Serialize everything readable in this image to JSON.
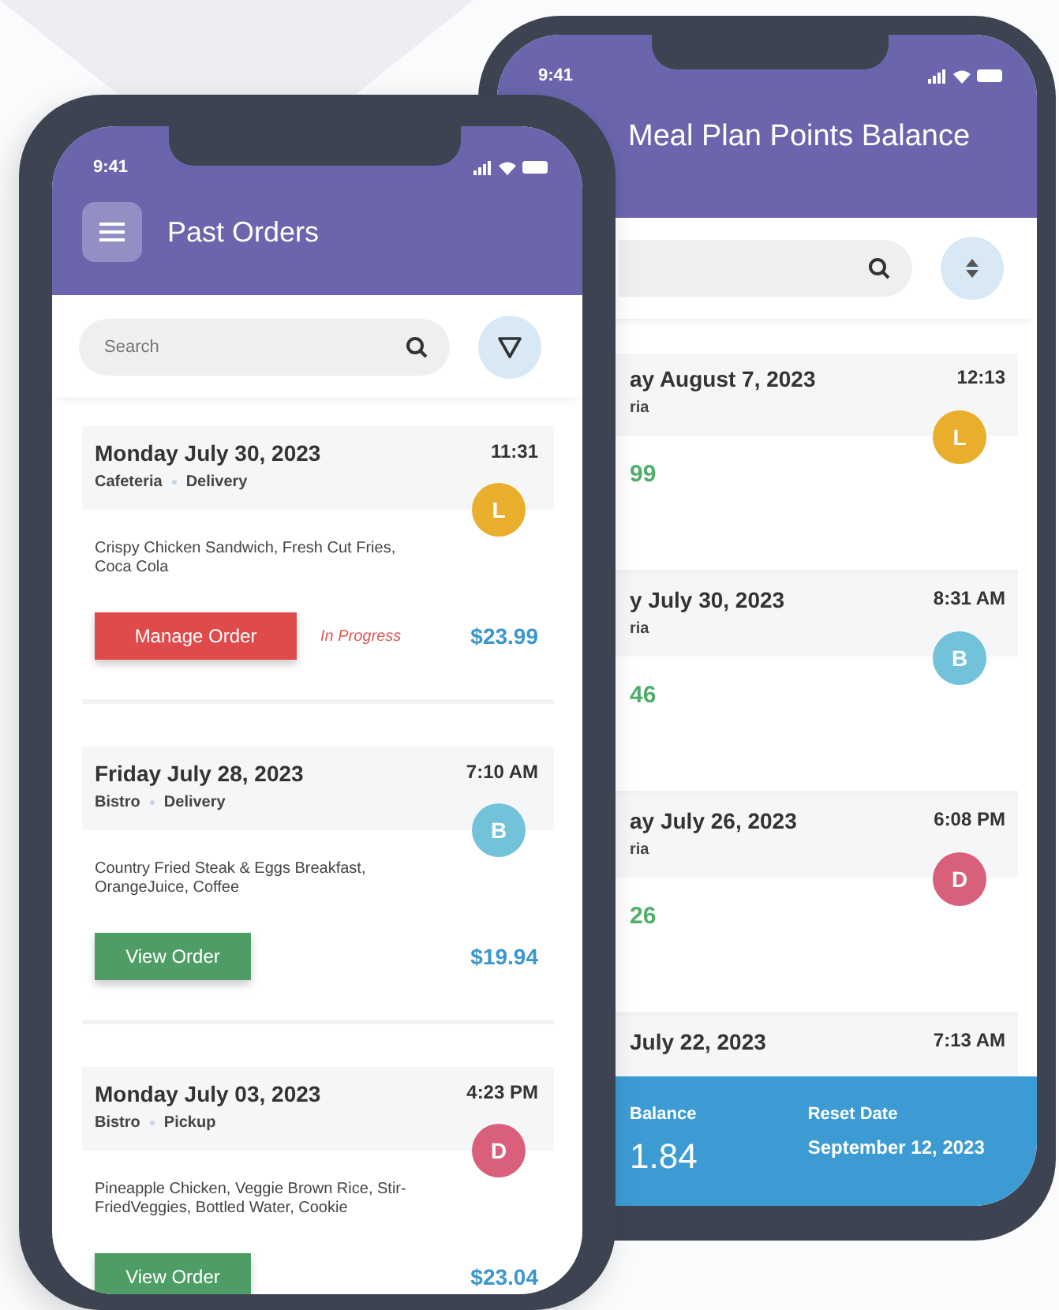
{
  "back_phone": {
    "status_time": "9:41",
    "title": "Meal Plan Points Balance",
    "orders": [
      {
        "date": "ay August 7, 2023",
        "location": "ria",
        "time": "12:13",
        "avatar": "L",
        "color": "#e8ae2c",
        "amount": "99"
      },
      {
        "date": "y July 30, 2023",
        "location": "ria",
        "time": "8:31 AM",
        "avatar": "B",
        "color": "#72c2d9",
        "amount": "46"
      },
      {
        "date": "ay July 26, 2023",
        "location": "ria",
        "time": "6:08 PM",
        "avatar": "D",
        "color": "#d9607a",
        "amount": "26"
      },
      {
        "date": "July 22, 2023",
        "time": "7:13 AM"
      }
    ],
    "footer": {
      "balance_label": "Balance",
      "balance": "1.84",
      "reset_label": "Reset Date",
      "reset_date": "September 12, 2023"
    }
  },
  "front_phone": {
    "status_time": "9:41",
    "title": "Past Orders",
    "search": {
      "placeholder": "Search"
    },
    "orders": [
      {
        "date": "Monday July 30, 2023",
        "location": "Cafeteria",
        "method": "Delivery",
        "time": "11:31",
        "avatar": "L",
        "color": "#e8ae2c",
        "description": "Crispy Chicken Sandwich, Fresh Cut Fries, Coca Cola",
        "action": {
          "label": "Manage Order",
          "kind": "manage"
        },
        "status": "In Progress",
        "amount": "$23.99"
      },
      {
        "date": "Friday July 28, 2023",
        "location": "Bistro",
        "method": "Delivery",
        "time": "7:10 AM",
        "avatar": "B",
        "color": "#72c2d9",
        "description": "Country Fried Steak & Eggs Breakfast, OrangeJuice, Coffee",
        "action": {
          "label": "View Order",
          "kind": "view"
        },
        "amount": "$19.94"
      },
      {
        "date": "Monday July 03, 2023",
        "location": "Bistro",
        "method": "Pickup",
        "time": "4:23 PM",
        "avatar": "D",
        "color": "#d9607a",
        "description": "Pineapple Chicken, Veggie Brown Rice, Stir-FriedVeggies, Bottled Water, Cookie",
        "action": {
          "label": "View Order",
          "kind": "view"
        },
        "amount": "$23.04"
      }
    ]
  }
}
